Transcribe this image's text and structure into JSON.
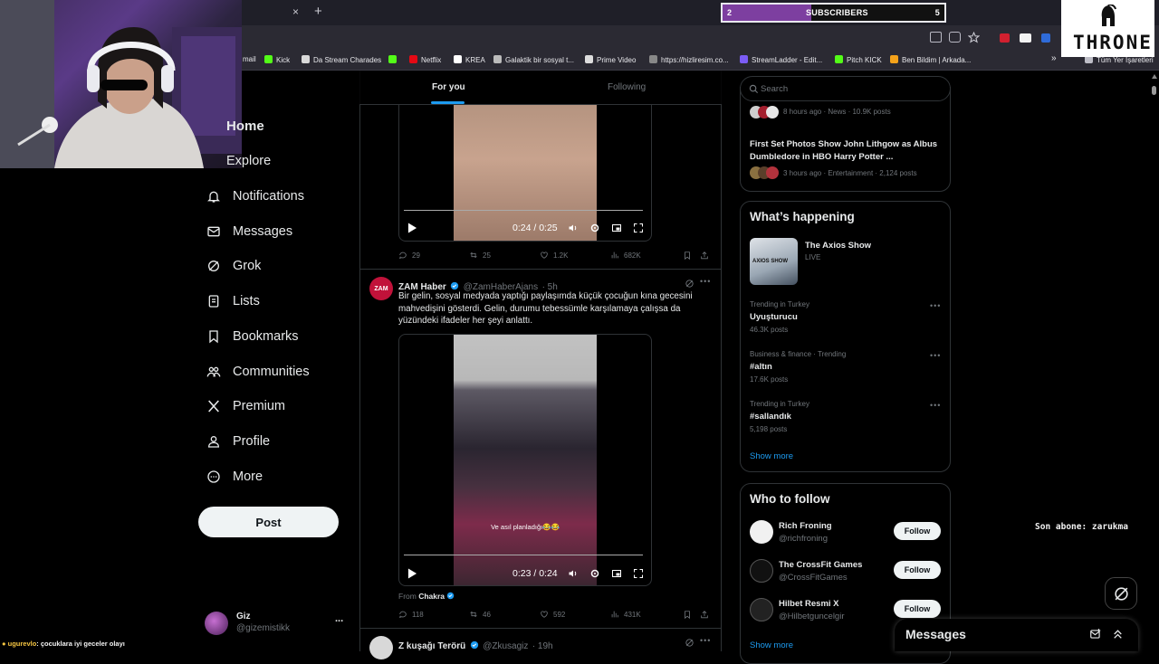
{
  "browser": {
    "new_tab": "+",
    "close_tab": "×",
    "bookmarks": [
      {
        "label": "mail",
        "color": "#3b3b44"
      },
      {
        "label": "Kick",
        "color": "#53fc18"
      },
      {
        "label": "Da Stream Charades",
        "color": "#d9d9d9"
      },
      {
        "label": "",
        "color": "#53fc18"
      },
      {
        "label": "Netflix",
        "color": "#e50914"
      },
      {
        "label": "KREA",
        "color": "#ffffff"
      },
      {
        "label": "Galaktik bir sosyal t...",
        "color": "#bbbbbb"
      },
      {
        "label": "Prime Video",
        "color": "#dddddd"
      },
      {
        "label": "https://hizliresim.co...",
        "color": "#888888"
      },
      {
        "label": "StreamLadder - Edit...",
        "color": "#7b5cf5"
      },
      {
        "label": "Pitch KICK",
        "color": "#53fc18"
      },
      {
        "label": "Ben Bildim | Arkada...",
        "color": "#f4a21a"
      }
    ],
    "all_bookmarks": "Tüm Yer İşaretleri",
    "more_bookmarks": "»"
  },
  "overlay": {
    "subscribers_label": "SUBSCRIBERS",
    "subscribers_current": "2",
    "subscribers_goal": "5",
    "subscribers_progress": 0.4,
    "brand": "THRONE",
    "last_subscriber": "Son abone: zarukma",
    "chat_user": "ugurevlo",
    "chat_message": ": çocuklara iyi geceler olayı",
    "accent": "#7d3fa0"
  },
  "sidebar": {
    "items": [
      {
        "label": "Home"
      },
      {
        "label": "Explore"
      },
      {
        "label": "Notifications"
      },
      {
        "label": "Messages"
      },
      {
        "label": "Grok"
      },
      {
        "label": "Lists"
      },
      {
        "label": "Bookmarks"
      },
      {
        "label": "Communities"
      },
      {
        "label": "Premium"
      },
      {
        "label": "Profile"
      },
      {
        "label": "More"
      }
    ],
    "post_label": "Post",
    "account": {
      "name": "Giz",
      "handle": "@gizemistikk",
      "more": "..."
    }
  },
  "feed": {
    "tabs": [
      "For you",
      "Following"
    ],
    "tweet1": {
      "video_time": "0:24 / 0:25",
      "replies": "29",
      "reposts": "25",
      "likes": "1.2K",
      "views": "682K"
    },
    "tweet2": {
      "name": "ZAM Haber",
      "handle": "@ZamHaberAjans",
      "time": "· 5h",
      "avatar_text": "ZAM",
      "text": "Bir gelin, sosyal medyada yaptığı paylaşımda küçük çocuğun kına gecesini mahvedişini gösterdi. Gelin, durumu tebessümle karşılamaya çalışsa da yüzündeki ifadeler her şeyi anlattı.",
      "caption": "Ve asıl planladığı😂😂",
      "video_time": "0:23 / 0:24",
      "from_label": "From",
      "from_source": "Chakra",
      "replies": "118",
      "reposts": "46",
      "likes": "592",
      "views": "431K"
    },
    "tweet3": {
      "name": "Z kuşağı Terörü",
      "handle": "@Zkusagiz",
      "time": "· 19h"
    }
  },
  "right": {
    "search_placeholder": "Search",
    "news": [
      {
        "meta": "8 hours ago · News · 10.9K posts"
      },
      {
        "title": "First Set Photos Show John Lithgow as Albus Dumbledore in HBO Harry Potter ...",
        "meta": "3 hours ago · Entertainment · 2,124 posts"
      }
    ],
    "happening_title": "What’s happening",
    "live_show": {
      "title": "The Axios Show",
      "status": "LIVE",
      "thumb_text": "AXIOS SHOW"
    },
    "trends": [
      {
        "context": "Trending in Turkey",
        "name": "Uyuşturucu",
        "posts": "46.3K posts"
      },
      {
        "context": "Business & finance · Trending",
        "name": "#altın",
        "posts": "17.6K posts"
      },
      {
        "context": "Trending in Turkey",
        "name": "#sallandık",
        "posts": "5,198 posts"
      }
    ],
    "show_more": "Show more",
    "who_to_follow_title": "Who to follow",
    "follow_label": "Follow",
    "follow": [
      {
        "name": "Rich Froning",
        "handle": "@richfroning"
      },
      {
        "name": "The CrossFit Games",
        "handle": "@CrossFitGames"
      },
      {
        "name": "Hilbet Resmi X",
        "handle": "@Hilbetguncelgir"
      }
    ],
    "show_more2": "Show more"
  },
  "messages_drawer": {
    "title": "Messages"
  }
}
